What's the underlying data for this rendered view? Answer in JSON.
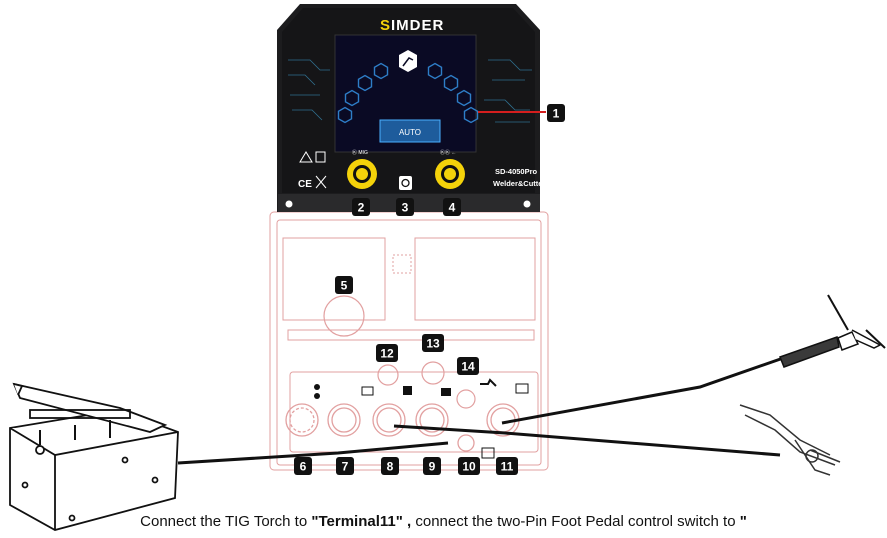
{
  "brand": {
    "name": "SIMDER",
    "initial": "S",
    "rest": "IMDER"
  },
  "panel": {
    "model": "SD-4050Pro",
    "subtitle": "Welder&Cutter",
    "left_knob_label": "Ⓚ MIG",
    "right_knob_label": "ⓀⓀ ←",
    "screen_mode": "AUTO"
  },
  "callouts": [
    "1",
    "2",
    "3",
    "4",
    "5",
    "6",
    "7",
    "8",
    "9",
    "10",
    "11",
    "12",
    "13",
    "14"
  ],
  "caption": {
    "part1": "Connect the TIG Torch to ",
    "highlight": "\"Terminal11\" ,",
    "part2": " connect the two-Pin Foot Pedal control switch to ",
    "end": "\""
  },
  "colors": {
    "faceplate": "#1c1c1e",
    "screen": "#0a0a24",
    "knob": "#f4d20a",
    "accent_line": "#d41e1e",
    "badge": "#111111",
    "body_outline": "#e2a0a0"
  }
}
